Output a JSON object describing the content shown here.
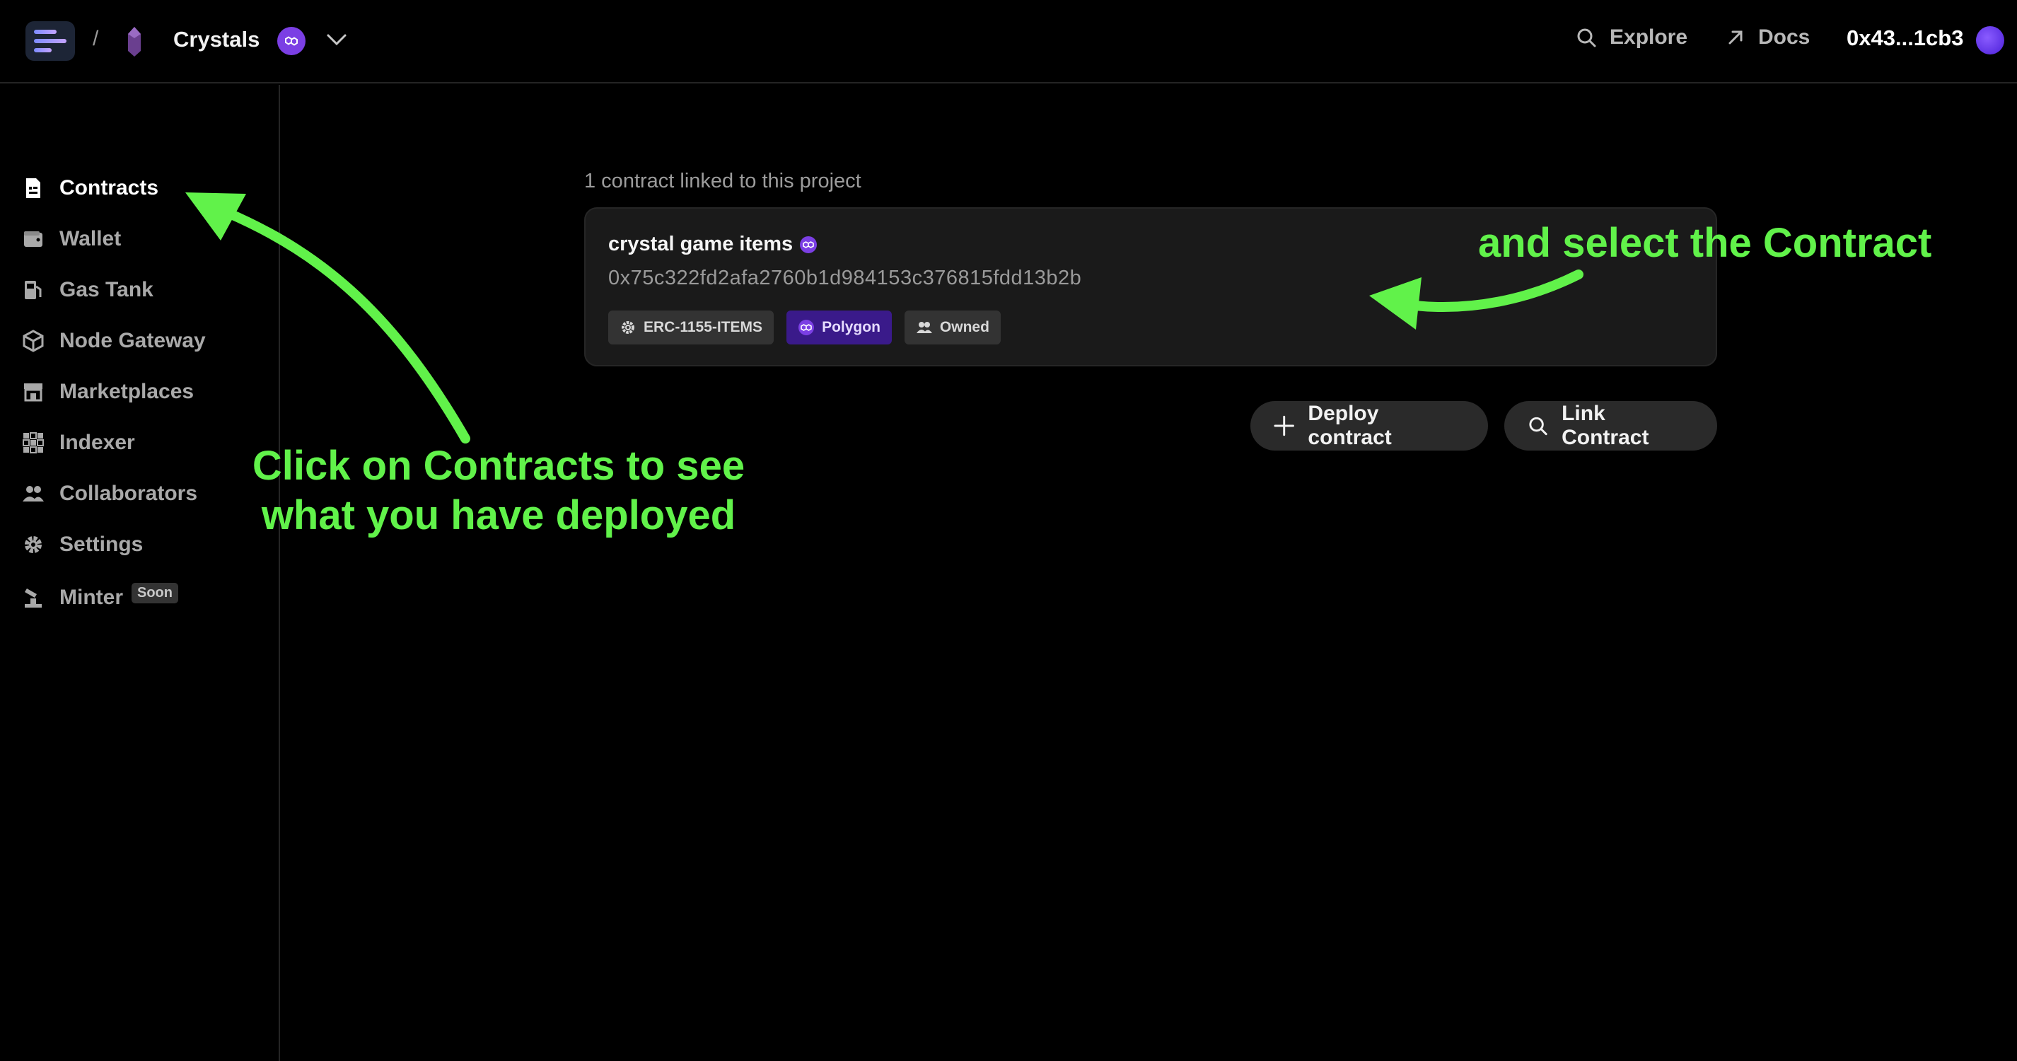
{
  "header": {
    "breadcrumb_sep": "/",
    "project_name": "Crystals",
    "explore_label": "Explore",
    "docs_label": "Docs",
    "wallet_address": "0x43...1cb3"
  },
  "sidebar": {
    "items": [
      {
        "label": "Contracts",
        "icon": "contract-icon",
        "active": true
      },
      {
        "label": "Wallet",
        "icon": "wallet-icon"
      },
      {
        "label": "Gas Tank",
        "icon": "gas-tank-icon"
      },
      {
        "label": "Node Gateway",
        "icon": "node-gateway-icon"
      },
      {
        "label": "Marketplaces",
        "icon": "marketplace-icon"
      },
      {
        "label": "Indexer",
        "icon": "indexer-icon"
      },
      {
        "label": "Collaborators",
        "icon": "collaborators-icon"
      },
      {
        "label": "Settings",
        "icon": "gear-icon"
      },
      {
        "label": "Minter",
        "icon": "minter-icon",
        "badge": "Soon"
      }
    ]
  },
  "main": {
    "linked_count_text": "1 contract linked to this project",
    "contract": {
      "name": "crystal game items",
      "address": "0x75c322fd2afa2760b1d984153c376815fdd13b2b",
      "tags": [
        "ERC-1155-ITEMS",
        "Polygon",
        "Owned"
      ]
    },
    "deploy_label": "Deploy contract",
    "link_label": "Link Contract"
  },
  "annotations": {
    "left_line1": "Click on Contracts to see",
    "left_line2": "what you have deployed",
    "right": "and select the Contract"
  },
  "colors": {
    "background": "#000000",
    "annotation": "#61f24a",
    "polygon": "#7b3fe4",
    "card": "#1a1a1a"
  }
}
